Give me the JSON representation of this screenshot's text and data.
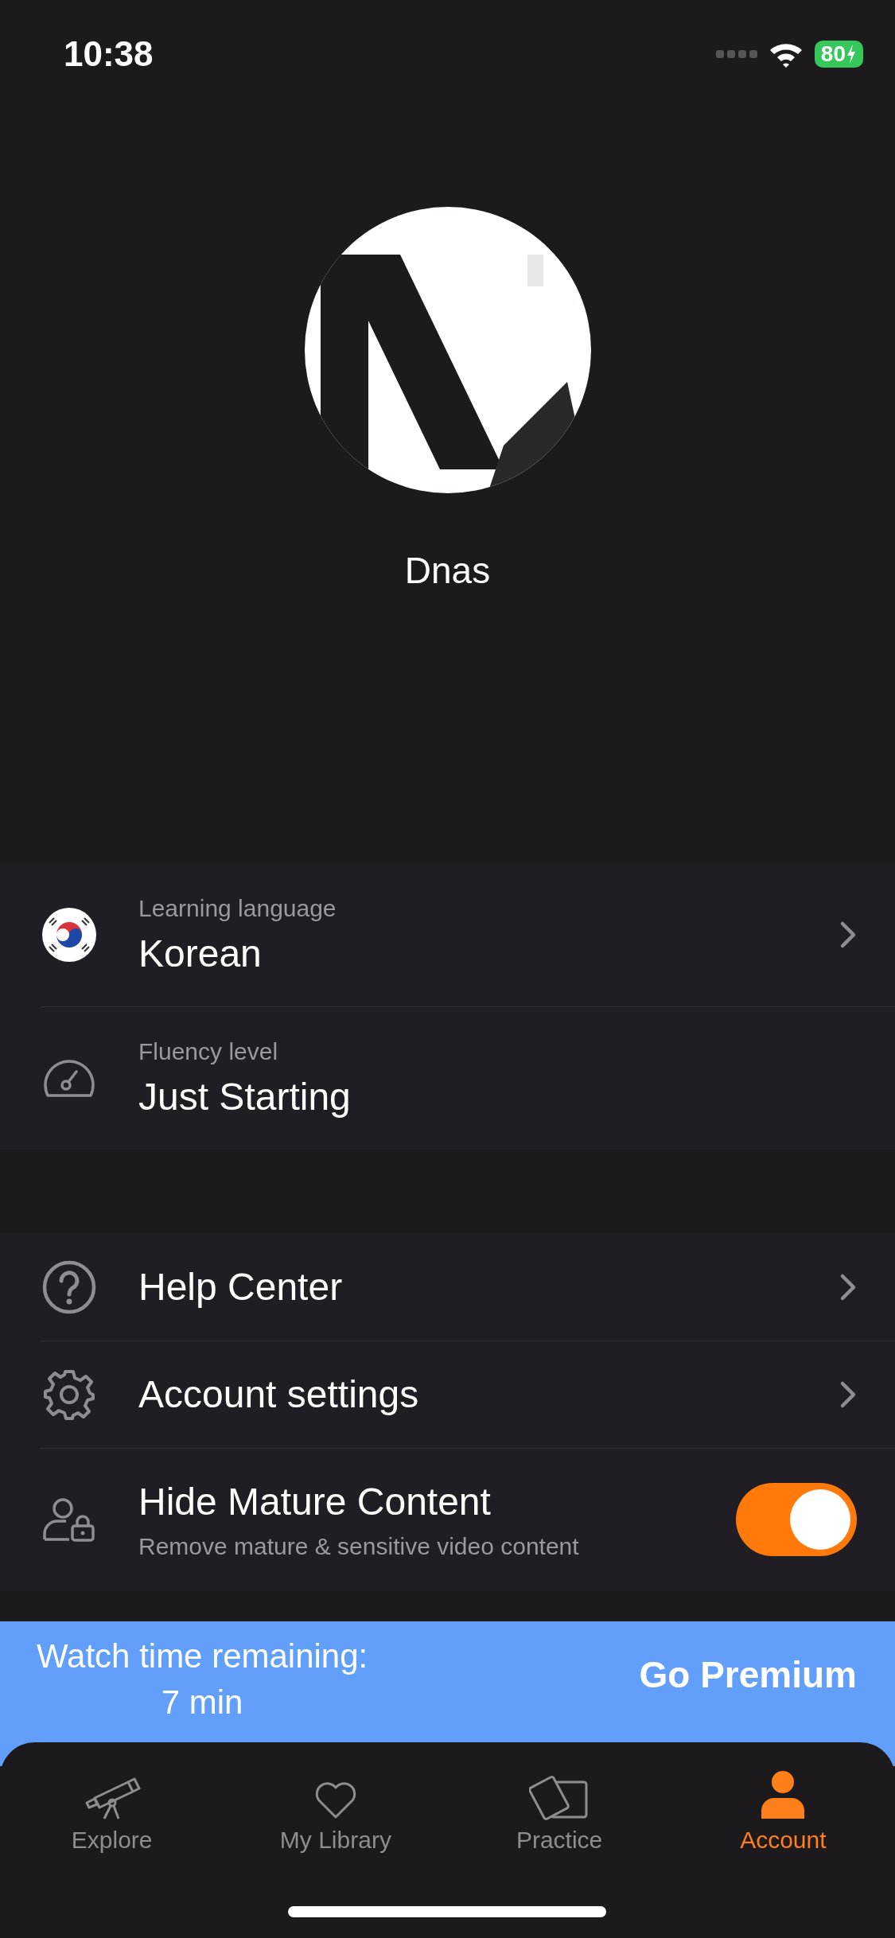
{
  "status_bar": {
    "time": "10:38",
    "battery": "80"
  },
  "profile": {
    "name": "Dnas"
  },
  "language_settings": [
    {
      "label": "Learning language",
      "value": "Korean",
      "chevron": true
    },
    {
      "label": "Fluency level",
      "value": "Just Starting",
      "chevron": false
    }
  ],
  "settings": [
    {
      "kind": "link",
      "label": "Help Center"
    },
    {
      "kind": "link",
      "label": "Account settings"
    },
    {
      "kind": "toggle",
      "label": "Hide Mature Content",
      "description": "Remove mature & sensitive video content",
      "on": true
    }
  ],
  "banner": {
    "text": "Watch time remaining:",
    "time": "7 min",
    "button": "Go Premium"
  },
  "tabs": [
    {
      "label": "Explore",
      "selected": false
    },
    {
      "label": "My Library",
      "selected": false
    },
    {
      "label": "Practice",
      "selected": false
    },
    {
      "label": "Account",
      "selected": true
    }
  ]
}
